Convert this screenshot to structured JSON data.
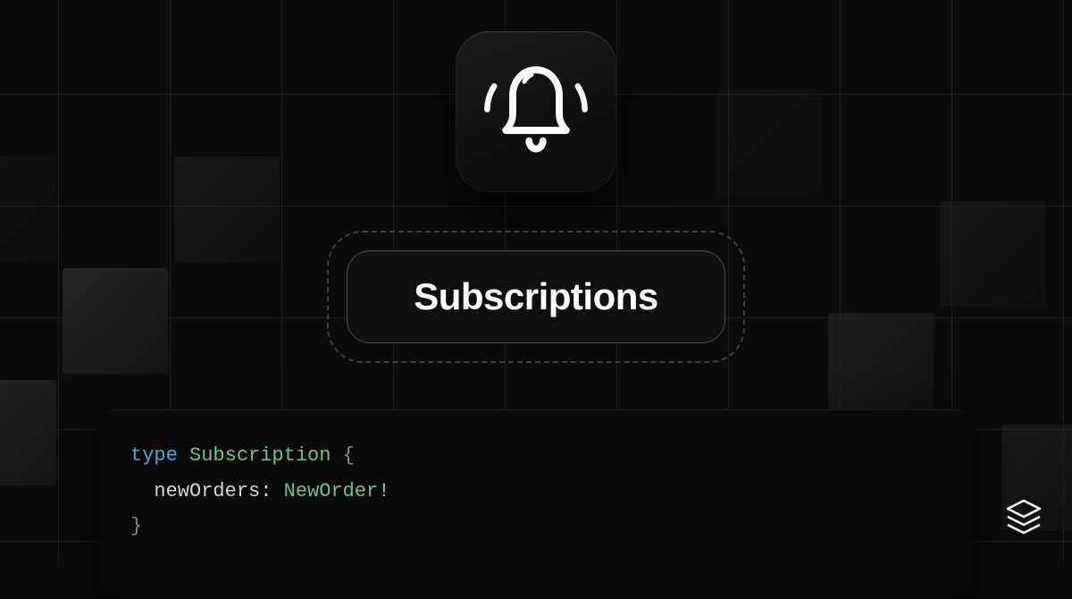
{
  "hero": {
    "icon": "bell-ringing-icon"
  },
  "pill": {
    "label": "Subscriptions"
  },
  "code": {
    "keyword": "type",
    "type_name": "Subscription",
    "open_brace": "{",
    "field_name": "newOrders",
    "colon": ":",
    "field_type": "NewOrder",
    "bang": "!",
    "close_brace": "}"
  },
  "footer": {
    "logo": "stack-logo-icon"
  },
  "colors": {
    "keyword": "#4ba8d8",
    "typename": "#6dc28f",
    "text": "#ffffff",
    "muted": "#888888"
  }
}
